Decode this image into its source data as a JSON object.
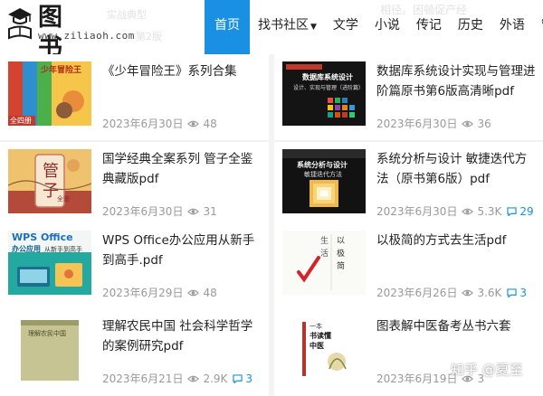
{
  "site": {
    "logo_title": "图书网",
    "logo_url": "www.ziliaoh.com",
    "ghost_text_1": "实战典型",
    "ghost_text_2": "第2版",
    "ghost_text_3": "相径。困顿促产经"
  },
  "nav": [
    {
      "label": "首页",
      "active": true
    },
    {
      "label": "找书社区",
      "dropdown": true
    },
    {
      "label": "文学"
    },
    {
      "label": "小说"
    },
    {
      "label": "传记"
    },
    {
      "label": "历史"
    },
    {
      "label": "外语"
    },
    {
      "label": "管理"
    }
  ],
  "books": [
    {
      "title": "《少年冒险王》系列合集",
      "date": "2023年6月30日",
      "views": "48",
      "comments": ""
    },
    {
      "title": "数据库系统设计实现与管理进阶篇原书第6版高清晰pdf",
      "date": "2023年6月30日",
      "views": "36",
      "comments": ""
    },
    {
      "title": "国学经典全案系列 管子全鉴 典藏版pdf",
      "date": "2023年6月30日",
      "views": "31",
      "comments": ""
    },
    {
      "title": "系统分析与设计 敏捷迭代方法（原书第6版）pdf",
      "date": "2023年6月30日",
      "views": "5.3K",
      "comments": "29"
    },
    {
      "title": "WPS Office办公应用从新手到高手.pdf",
      "date": "2023年6月29日",
      "views": "48",
      "comments": ""
    },
    {
      "title": "以极简的方式去生活pdf",
      "date": "2023年6月26日",
      "views": "3.6K",
      "comments": "3"
    },
    {
      "title": "理解农民中国 社会科学哲学的案例研究pdf",
      "date": "2023年6月21日",
      "views": "2.9K",
      "comments": "3"
    },
    {
      "title": "图表解中医备考丛书六套",
      "date": "2023年6月19日",
      "views": "3",
      "comments": ""
    }
  ],
  "thumb_text": {
    "b1": "少年冒险王",
    "b1_tag": "全四册",
    "b2_top": "数据库系统设计",
    "b2_sub": "设计、实现与管理（进阶篇）",
    "b3_a": "管",
    "b3_b": "子",
    "b3_c": "全鉴",
    "b4_a": "系统分析与设计",
    "b4_b": "敏捷迭代方法",
    "b5_a": "WPS Office",
    "b5_b": "办公应用",
    "b5_c": "从新手到高手",
    "b6_a": "以",
    "b6_b": "极",
    "b6_c": "简",
    "b6_d": "生",
    "b6_e": "活",
    "b7": "理解农民中国",
    "b8_a": "一本",
    "b8_b": "书读懂",
    "b8_c": "中医"
  },
  "watermark": "知乎 @夏至",
  "colors": {
    "accent": "#1a90e2"
  }
}
